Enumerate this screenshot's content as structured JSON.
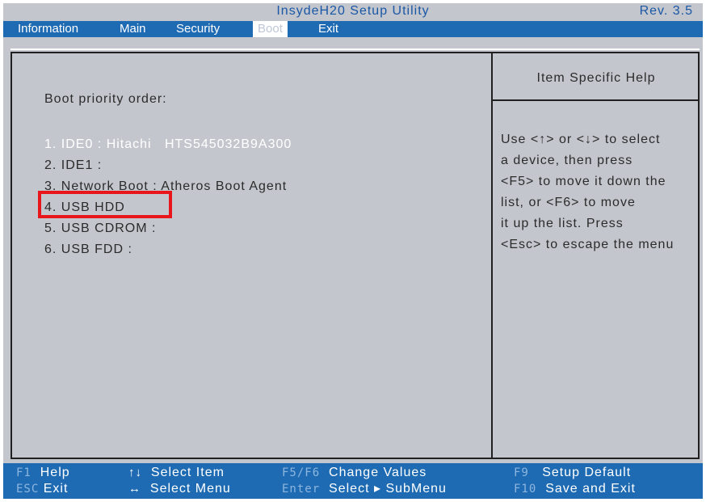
{
  "window": {
    "title": "InsydeH20 Setup Utility",
    "revision": "Rev. 3.5"
  },
  "menu": {
    "items": [
      {
        "label": "Information",
        "active": false
      },
      {
        "label": "Main",
        "active": false
      },
      {
        "label": "Security",
        "active": false
      },
      {
        "label": "Boot",
        "active": true
      },
      {
        "label": "Exit",
        "active": false
      }
    ]
  },
  "boot": {
    "label": "Boot priority order:",
    "items": [
      {
        "text": "1. IDE0 : Hitachi   HTS545032B9A300",
        "selected": true
      },
      {
        "text": "2. IDE1 :",
        "selected": false
      },
      {
        "text": "3. Network Boot : Atheros Boot Agent",
        "selected": false
      },
      {
        "text": "4. USB HDD",
        "selected": false,
        "highlighted": true
      },
      {
        "text": "5. USB CDROM :",
        "selected": false
      },
      {
        "text": "6. USB FDD :",
        "selected": false
      }
    ]
  },
  "help": {
    "title": "Item Specific Help",
    "lines": [
      "Use <↑> or <↓> to select",
      "a device, then press",
      "<F5> to move it down the",
      "list, or <F6> to move",
      "it up the list. Press",
      "<Esc> to escape the menu"
    ]
  },
  "status": {
    "row1": [
      {
        "key": "F1",
        "desc": "Help"
      },
      {
        "key": "↑↓",
        "desc": "Select  Item"
      },
      {
        "key": "F5/F6",
        "desc": "Change Values"
      },
      {
        "key": "F9",
        "desc": "Setup Default"
      }
    ],
    "row2": [
      {
        "key": "ESC",
        "desc": "Exit"
      },
      {
        "key": "↔",
        "desc": "Select  Menu"
      },
      {
        "key": "Enter",
        "desc": "Select ▸ SubMenu"
      },
      {
        "key": "F10",
        "desc": "Save and Exit"
      }
    ]
  },
  "colors": {
    "accent": "#1e6bb3",
    "background": "#c3c7cd",
    "highlight_border": "#e8161a"
  }
}
